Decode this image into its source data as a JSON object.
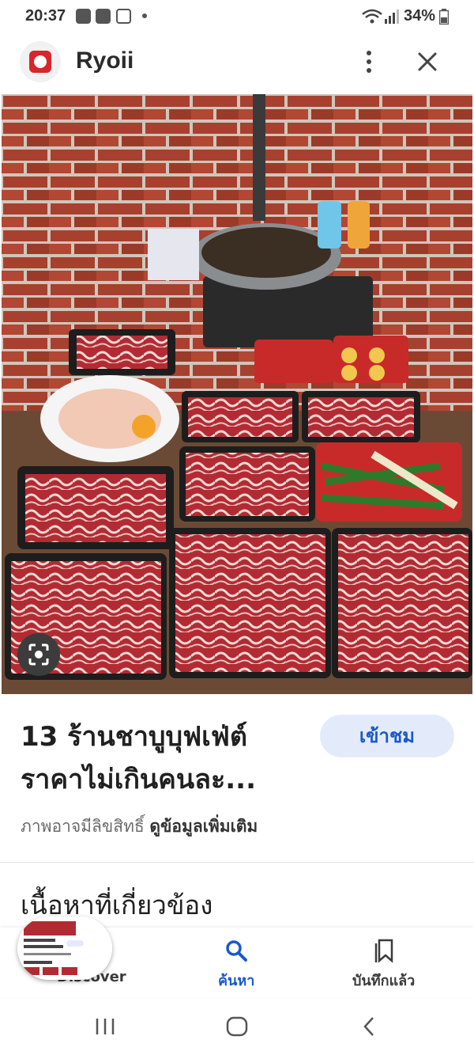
{
  "status_bar": {
    "time": "20:37",
    "battery": "34%",
    "icons": [
      "play-icon",
      "youtube-icon",
      "instagram-icon",
      "wifi-icon",
      "signal-icon",
      "battery-icon"
    ]
  },
  "header": {
    "site_name": "Ryoii",
    "icons": [
      "site-favicon",
      "more-vert-icon",
      "close-icon"
    ]
  },
  "image": {
    "description_icon": "lens-icon"
  },
  "result": {
    "headline_line1": "13 ร้านชาบูบุฟเฟ่ต์",
    "headline_line2": "ราคาไม่เกินคนละ...",
    "visit_label": "เข้าชม",
    "copyright_text": "ภาพอาจมีลิขสิทธิ์",
    "more_info": "ดูข้อมูลเพิ่มเติม"
  },
  "related": {
    "title": "เนื้อหาที่เกี่ยวข้อง"
  },
  "bottom_nav": {
    "discover": "Discover",
    "search": "ค้นหา",
    "saved": "บันทึกแล้ว"
  },
  "colors": {
    "accent": "#1a59c9",
    "visit_bg": "#e3ebfb",
    "brick": "#a8402f"
  }
}
